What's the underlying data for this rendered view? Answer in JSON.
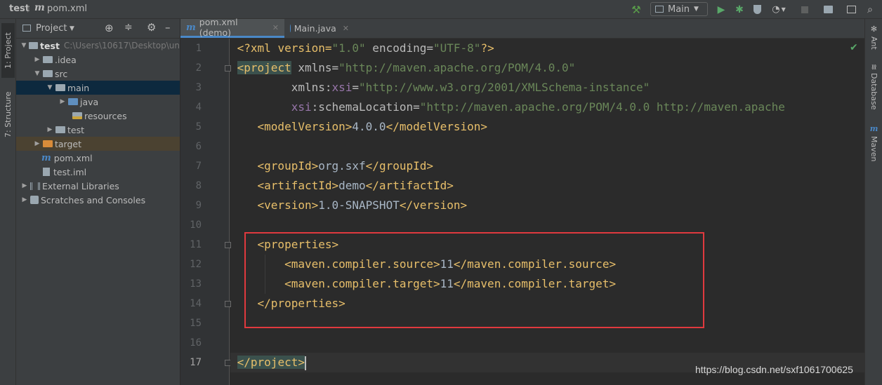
{
  "breadcrumb": {
    "project": "test",
    "file": "pom.xml"
  },
  "toolbar": {
    "run_config": "Main"
  },
  "left_stripe": {
    "project_tab": "1: Project",
    "structure_tab": "7: Structure"
  },
  "project_panel": {
    "title": "Project",
    "root_name": "test",
    "root_path": "C:\\Users\\10617\\Desktop\\un",
    "items": [
      {
        "label": "test"
      },
      {
        "label": ".idea"
      },
      {
        "label": "src"
      },
      {
        "label": "main"
      },
      {
        "label": "java"
      },
      {
        "label": "resources"
      },
      {
        "label": "test"
      },
      {
        "label": "target"
      },
      {
        "label": "pom.xml"
      },
      {
        "label": "test.iml"
      },
      {
        "label": "External Libraries"
      },
      {
        "label": "Scratches and Consoles"
      }
    ]
  },
  "editor_tabs": [
    {
      "label": "pom.xml (demo)"
    },
    {
      "label": "Main.java"
    }
  ],
  "line_numbers": [
    "1",
    "2",
    "3",
    "4",
    "5",
    "6",
    "7",
    "8",
    "9",
    "10",
    "11",
    "12",
    "13",
    "14",
    "15",
    "16",
    "17"
  ],
  "code": {
    "l1": {
      "a": "<?xml version=",
      "b": "\"1.0\"",
      "c": " encoding=",
      "d": "\"UTF-8\"",
      "e": "?>"
    },
    "l2": {
      "a": "<project",
      "b": " xmlns=",
      "c": "\"http://maven.apache.org/POM/4.0.0\""
    },
    "l3": {
      "a": "         xmlns:",
      "b": "xsi",
      "c": "=",
      "d": "\"http://www.w3.org/2001/XMLSchema-instance\""
    },
    "l4": {
      "a": "         ",
      "b": "xsi",
      "c": ":schemaLocation=",
      "d": "\"http://maven.apache.org/POM/4.0.0 http://maven.apache"
    },
    "l5": {
      "a": "    <modelVersion>",
      "b": "4.0.0",
      "c": "</modelVersion>"
    },
    "l7": {
      "a": "    <groupId>",
      "b": "org.sxf",
      "c": "</groupId>"
    },
    "l8": {
      "a": "    <artifactId>",
      "b": "demo",
      "c": "</artifactId>"
    },
    "l9": {
      "a": "    <version>",
      "b": "1.0-SNAPSHOT",
      "c": "</version>"
    },
    "l11": {
      "a": "    <properties>"
    },
    "l12": {
      "a": "        <maven.compiler.source>",
      "b": "11",
      "c": "</maven.compiler.source>"
    },
    "l13": {
      "a": "        <maven.compiler.target>",
      "b": "11",
      "c": "</maven.compiler.target>"
    },
    "l14": {
      "a": "    </properties>"
    },
    "l17": {
      "a": "</project>"
    }
  },
  "right_stripe": {
    "ant": "Ant",
    "database": "Database",
    "maven": "Maven"
  },
  "watermark": "https://blog.csdn.net/sxf1061700625",
  "colors": {
    "accent": "#4a88c7",
    "highlight_box": "#e0393e",
    "tag": "#e8bf6a",
    "string": "#6a8759"
  }
}
